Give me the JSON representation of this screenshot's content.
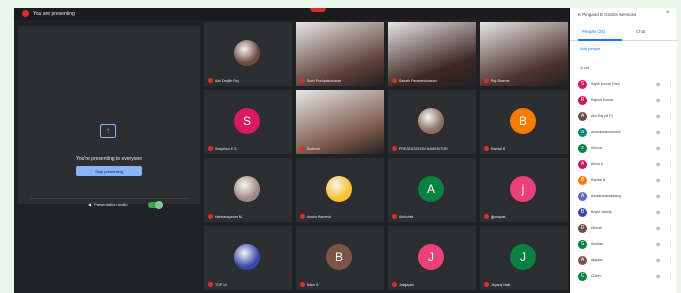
{
  "top": {
    "presenting_label": "You are presenting"
  },
  "presentation": {
    "message": "You're presenting to everyone",
    "stop_button": "Stop presenting",
    "audio_label": "Presentation audio"
  },
  "tiles": [
    {
      "name": "Adv Dwijith Raj",
      "kind": "avatar-photo",
      "color": "#6d4c41"
    },
    {
      "name": "Sunil Pushpakumaran",
      "kind": "video",
      "color": "#5d4037"
    },
    {
      "name": "Sanath Parameshwaran",
      "kind": "video",
      "color": "#3e2723"
    },
    {
      "name": "Raj Sharma",
      "kind": "video",
      "color": "#4e342e"
    },
    {
      "name": "Shajahan K S",
      "kind": "letter",
      "letter": "S",
      "color": "#d81b60"
    },
    {
      "name": "Sudheer",
      "kind": "video",
      "color": "#795548"
    },
    {
      "name": "PRESENTATION NAMEDITOR",
      "kind": "avatar-photo",
      "color": "#8d6e63"
    },
    {
      "name": "Ramlal B",
      "kind": "letter",
      "letter": "B",
      "color": "#f57c00"
    },
    {
      "name": "Harinarayanan M.",
      "kind": "avatar-photo",
      "color": "#a1887f"
    },
    {
      "name": "Anshu Ramesh",
      "kind": "avatar-photo",
      "color": "#fbc02d"
    },
    {
      "name": "Abhishek",
      "kind": "letter",
      "letter": "A",
      "color": "#0b8043"
    },
    {
      "name": "jijjonayak",
      "kind": "letter",
      "letter": "j",
      "color": "#ec407a"
    },
    {
      "name": "TOP 10",
      "kind": "avatar-photo",
      "color": "#3949ab"
    },
    {
      "name": "Babu S",
      "kind": "letter",
      "letter": "B",
      "color": "#795548"
    },
    {
      "name": "Jalajayan",
      "kind": "letter",
      "letter": "J",
      "color": "#ec407a"
    },
    {
      "name": "Jeyaraj Naik",
      "kind": "letter",
      "letter": "J",
      "color": "#0b8043"
    }
  ],
  "sidebar": {
    "title": "K Pingand E Grants Services",
    "tab_people": "People (25)",
    "tab_chat": "Chat",
    "add_people": "Add people",
    "section_label": "In call",
    "participants": [
      {
        "name": "Sajith Kumar (You)",
        "letter": "S",
        "color": "#d81b60"
      },
      {
        "name": "Rajesh Kumar",
        "letter": "R",
        "color": "#c2185b"
      },
      {
        "name": "Abc Raj (M P)",
        "letter": "A",
        "color": "#6d4c41"
      },
      {
        "name": "arnavkadaverkozhi",
        "letter": "a",
        "color": "#00897b"
      },
      {
        "name": "Sriniva",
        "letter": "s",
        "color": "#0b8043"
      },
      {
        "name": "Aisha K",
        "letter": "A",
        "color": "#c2185b"
      },
      {
        "name": "Ramlal B",
        "letter": "B",
        "color": "#f57c00"
      },
      {
        "name": "Asokkumaraswamy",
        "letter": "A",
        "color": "#5c6bc0"
      },
      {
        "name": "Bright Variety",
        "letter": "B",
        "color": "#3949ab"
      },
      {
        "name": "Dinesh",
        "letter": "D",
        "color": "#6d4c41"
      },
      {
        "name": "Sundari",
        "letter": "S",
        "color": "#0b8043"
      },
      {
        "name": "Ajayam",
        "letter": "A",
        "color": "#795548"
      },
      {
        "name": "CUser",
        "letter": "C",
        "color": "#0b8043"
      }
    ]
  }
}
